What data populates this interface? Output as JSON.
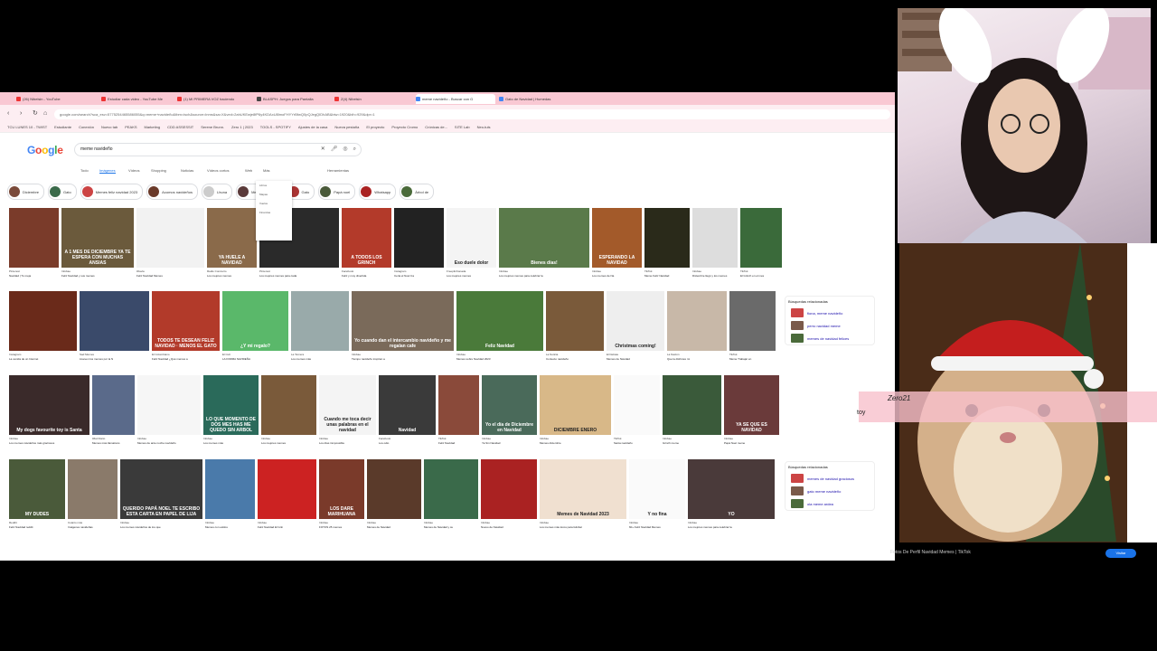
{
  "browser": {
    "tabs": [
      {
        "label": "(26) Nibelsin - YouTube",
        "color": "#e33"
      },
      {
        "label": "Estudiar cada video - YouTube Me",
        "color": "#e33"
      },
      {
        "label": "(1) MI PRIMERA VOZ haciendo",
        "color": "#e33"
      },
      {
        "label": "BLASPH: Juegos para Pantalla",
        "color": "#444"
      },
      {
        "label": "Z(4) Nibelsin",
        "color": "#e33"
      },
      {
        "label": "meme navideño - Buscar con G",
        "color": "#4285f4"
      },
      {
        "label": "Gato de Navidad | Humedas",
        "color": "#4285f4"
      }
    ],
    "url": "google.com/search?sca_esv=5775254465586055&q=meme+navideño&tbm=isch&source=lnms&sa=X&ved=2ahUKEwje8fP6y4KDAxU8lmoFHYYrBfwQ0pQJegQIDhAB&biw=1920&bih=929&dpr=1",
    "bookmarks": [
      "TCU LUNES 10 - TWIST",
      "Estudiante",
      "Conexión",
      "Nuevo tab",
      "PEAKS",
      "Marketing",
      "CDD ASSESSIT",
      "Serene Brunn.",
      "Zero 1 | 2023",
      "TOOLS - SPOTIFY",
      "Ajustes de la casa",
      "Nueva pestaña",
      "El proyecto",
      "Proyecto Cromo",
      "Crónicas de...",
      "SITE Lab",
      "Neo-tuls"
    ]
  },
  "google": {
    "logo": "Google",
    "query": "meme navideño",
    "tabs": [
      "Todo",
      "Imágenes",
      "Vídeos",
      "Shopping",
      "Noticias",
      "Vídeos cortos",
      "Web",
      "Más",
      "Herramientas"
    ],
    "active_tab": "Imágenes",
    "chips": [
      "Diciembre",
      "Gato",
      "Memes feliz navidad 2023",
      "Acomos navideños",
      "Lhuna",
      "Mejores memes",
      "Gato",
      "Papá noel",
      "Whatsapp",
      "Árbol de"
    ],
    "more_menu": [
      "Libros",
      "Mapas",
      "Vuelos",
      "Finanzas"
    ],
    "related_1": {
      "title": "Búsquedas relacionadas",
      "items": [
        "fiona, meme navideño",
        "perro navidad meme",
        "memes de navidad felices"
      ]
    },
    "related_2": {
      "title": "Búsquedas relacionadas",
      "items": [
        "memes de navidad graciosos",
        "gato meme navideño",
        "ola meme ardea"
      ]
    }
  },
  "rows": [
    {
      "items": [
        {
          "src": "Pinterest",
          "title": "Navidad | Tu meja",
          "color": "#7a3b2a",
          "text": ""
        },
        {
          "src": "Infobae",
          "title": "Feliz Navidad y sus memes",
          "color": "#6b5a3c",
          "text": "A 1 MES DE DICIEMBRE YA TE ESPERA CON MUCHAS ANSIAS"
        },
        {
          "src": "iFlavia",
          "title": "Feliz Navidad Memes",
          "color": "#f2f2f2",
          "text": ""
        },
        {
          "src": "Radio Concierto",
          "title": "Los mejores memes",
          "color": "#8a6a4a",
          "text": "YA HUELE A NAVIDAD"
        },
        {
          "src": "Pinterest",
          "title": "Los mejores memes para cada",
          "color": "#2a2a2a",
          "text": ""
        },
        {
          "src": "Facebook",
          "title": "Feliz y muy divertida",
          "color": "#b33a2a",
          "text": "A TODOS LOS GRINCH"
        },
        {
          "src": "Instagram",
          "title": "Ceria el Noel Ca",
          "color": "#222",
          "text": ""
        },
        {
          "src": "Freepik/Canada",
          "title": "Los mejores memes",
          "color": "#f4f4f4",
          "text": "Eso duele dolor"
        },
        {
          "src": "Infobae",
          "title": "Los mejores memes para celebrar la",
          "color": "#5a7a4a",
          "text": "Bienes días!"
        },
        {
          "src": "Infobae",
          "title": "Los memes de Na",
          "color": "#a35a2a",
          "text": "ESPERANDO LA NAVIDAD"
        },
        {
          "src": "TikTok",
          "title": "Meme Feliz Navidad",
          "color": "#2a2a1a",
          "text": ""
        },
        {
          "src": "Infobae",
          "title": "Diciembre llegó y los memes",
          "color": "#ddd",
          "text": ""
        },
        {
          "src": "TikTok",
          "title": "El Grinch en el mes",
          "color": "#3a6a3a",
          "text": ""
        }
      ]
    },
    {
      "items": [
        {
          "src": "Instagram",
          "title": "La venida de un Internet",
          "color": "#6a2a1a",
          "text": ""
        },
        {
          "src": "Sad Memes",
          "title": "Llueven los memes por la N",
          "color": "#3a4a6a",
          "text": ""
        },
        {
          "src": "El Colombiano",
          "title": "Feliz Navidad ¿Qué memes a",
          "color": "#b23a2a",
          "text": "TODOS TE DESEAN FELIZ NAVIDAD · MENOS EL GATO"
        },
        {
          "src": "El Cult",
          "title": "LA FORMA NAVIDEÑA",
          "color": "#5ab86a",
          "text": "¿Y mi regalo?"
        },
        {
          "src": "La Tercera",
          "title": "Los memes más",
          "color": "#9aa",
          "text": ""
        },
        {
          "src": "Infobae",
          "title": "Tiempo navideño inspiran a",
          "color": "#7a6a5a",
          "text": "Yo cuando dan el intercambio navideño y me regalan cafe"
        },
        {
          "src": "Infobae",
          "title": "Memes sobre Navidad 2023",
          "color": "#4a7a3a",
          "text": "Feliz Navidad"
        },
        {
          "src": "La Noticia",
          "title": "Contexto navideño",
          "color": "#7a5a3a",
          "text": ""
        },
        {
          "src": "El Debate",
          "title": "Memes de Navidad",
          "color": "#eee",
          "text": "Christmas coming!"
        },
        {
          "src": "La Nación",
          "title": "Que la disfrutes mi",
          "color": "#c8b8a8",
          "text": ""
        },
        {
          "src": "TikTok",
          "title": "Meme Trabajar en",
          "color": "#6a6a6a",
          "text": ""
        }
      ]
    },
    {
      "items": [
        {
          "src": "Infobae",
          "title": "Los memes navideños más graciosos",
          "color": "#3a2a2a",
          "text": "My dogs favourite toy is Santa"
        },
        {
          "src": "iMat Diario",
          "title": "Memes más llamativos",
          "color": "#5a6a8a",
          "text": ""
        },
        {
          "src": "Infobae",
          "title": "Memes de ante noche navideño",
          "color": "#f6f6f6",
          "text": ""
        },
        {
          "src": "Infobae",
          "title": "Los memes más",
          "color": "#2a6a5a",
          "text": "LO QUE MOMENTO DE DOS MES HAS ME QUEDO SIN ARBOL"
        },
        {
          "src": "Infobae",
          "title": "Los mejores memes",
          "color": "#7a5a3a",
          "text": ""
        },
        {
          "src": "Infobae",
          "title": "Los días inmpossible",
          "color": "#f4f4f4",
          "text": "Cuando me toca decir unas palabras en el navidad"
        },
        {
          "src": "Facebook",
          "title": "Los odio",
          "color": "#3a3a3a",
          "text": "Navidad"
        },
        {
          "src": "TikTok",
          "title": "Feliz Navidad",
          "color": "#8a4a3a",
          "text": ""
        },
        {
          "src": "Infobae",
          "title": "Ya Sin Navidad",
          "color": "#4a6a5a",
          "text": "Yo el día de Diciembre en Navidad"
        },
        {
          "src": "Infobae",
          "title": "Memes diciembre",
          "color": "#d8b888",
          "text": "DICIEMBRE  ENERO"
        },
        {
          "src": "TikTok",
          "title": "Santa navideño",
          "color": "#fafafa",
          "text": ""
        },
        {
          "src": "Infobae",
          "title": "Grinch meme",
          "color": "#3a5a3a",
          "text": ""
        },
        {
          "src": "Infobae",
          "title": "Papá Noel meme",
          "color": "#6a3a3a",
          "text": "YA SE QUE ES NAVIDAD"
        }
      ]
    },
    {
      "items": [
        {
          "src": "Reddit",
          "title": "Feliz Navidad reddit",
          "color": "#4a5a3a",
          "text": "MY DUDES"
        },
        {
          "src": "Cuánto más",
          "title": "Imágenes navideñas",
          "color": "#8a7a6a",
          "text": ""
        },
        {
          "src": "Infobae",
          "title": "Los memes navideños de los que",
          "color": "#3a3a3a",
          "text": "QUERIDO PAPÁ NOEL TE ESCRIBO ESTA CARTA EN PAPEL DE LIJA"
        },
        {
          "src": "Infobae",
          "title": "Memes con estilos",
          "color": "#4a7aaa",
          "text": ""
        },
        {
          "src": "Infobae",
          "title": "Feliz Navidad El Grin",
          "color": "#c22",
          "text": ""
        },
        {
          "src": "Infobae",
          "title": "FOTOS 25 memes",
          "color": "#7a3a2a",
          "text": "LOS DARE MARIHUANA"
        },
        {
          "src": "Infobae",
          "title": "Memes de Navidad",
          "color": "#5a3a2a",
          "text": ""
        },
        {
          "src": "Infobae",
          "title": "Memes de Navidad y su",
          "color": "#3a6a4a",
          "text": ""
        },
        {
          "src": "Infobae",
          "title": "Nuevo de Navidad",
          "color": "#a22",
          "text": ""
        },
        {
          "src": "Infobae",
          "title": "Los memes más locos para felicitar",
          "color": "#f0e0d0",
          "text": "Memes de Navidad 2023"
        },
        {
          "src": "Infobae",
          "title": "60+ Feliz Navidad Memes",
          "color": "#fafafa",
          "text": "Y no fina"
        },
        {
          "src": "Infobae",
          "title": "Los mejores memes para celebrar la",
          "color": "#4a3a3a",
          "text": "YO"
        }
      ]
    }
  ],
  "stream": {
    "username": "Zero21",
    "overlay_text": "toy",
    "footer_caption": "Fotos De Perfil Navidad Memes | TikTok",
    "visit_button": "Visitar"
  }
}
